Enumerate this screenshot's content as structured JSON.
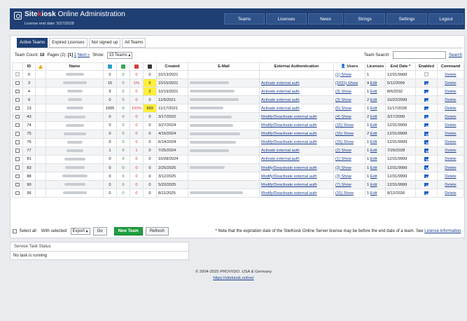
{
  "header": {
    "title_brand_1": "Site",
    "title_brand_2": "k",
    "title_brand_3": "iosk",
    "title_rest": " Online Administration",
    "license_end": "License end date: 5/27/2028",
    "nav": [
      "Teams",
      "Licenses",
      "News",
      "Strings",
      "Settings",
      "Logout"
    ]
  },
  "tabs": [
    "Active Teams",
    "Expired Licenses",
    "Not signed up",
    "All Teams"
  ],
  "toolbar": {
    "team_count_label": "Team Count:",
    "team_count": "18",
    "pages_label": "Pages (2):",
    "page_current": "[1]",
    "page_2": "2",
    "next": "Next »",
    "show_label": "Show:",
    "show_value": "15 Teams",
    "search_label": "Team Search:",
    "search_link": "Search"
  },
  "table": {
    "headers": [
      "",
      "ID",
      "",
      "Name",
      "",
      "",
      "",
      "",
      "Created",
      "E-Mail",
      "External Authentication",
      "Users",
      "Licenses",
      "End Date *",
      "Enabled",
      "Command"
    ],
    "rows": [
      {
        "id": "0",
        "n1": "0",
        "n2": "0",
        "n3": "0",
        "n4": "0",
        "created": "10/13/2021",
        "auth": "",
        "users": "(1) Show",
        "lic_n": "1",
        "lic_edit": "",
        "end": "12/31/9999",
        "cmd": "Delete"
      },
      {
        "id": "3",
        "n1": "15",
        "n2": "0",
        "n3": "1%",
        "n4": "5",
        "created": "10/15/2021",
        "auth": "Activate external auth",
        "users": "(1031) Show",
        "lic_n": "9",
        "lic_edit": "Edit",
        "end": "5/11/2099",
        "cmd": "Delete"
      },
      {
        "id": "4",
        "n1": "9",
        "n2": "0",
        "n3": "0",
        "n4": "2",
        "created": "10/19/2021",
        "auth": "Activate external auth",
        "users": "(3) Show",
        "lic_n": "1",
        "lic_edit": "Edit",
        "end": "8/6/2032",
        "cmd": "Delete"
      },
      {
        "id": "9",
        "n1": "0",
        "n2": "0",
        "n3": "0",
        "n4": "0",
        "created": "11/9/2021",
        "auth": "Activate external auth",
        "users": "(3) Show",
        "lic_n": "2",
        "lic_edit": "Edit",
        "end": "10/22/2099",
        "cmd": "Delete"
      },
      {
        "id": "13",
        "n1": "1005",
        "n2": "0",
        "n3": "100%",
        "n4": "999",
        "created": "11/17/2021",
        "auth": "Activate external auth",
        "users": "(5) Show",
        "lic_n": "1",
        "lic_edit": "Edit",
        "end": "11/17/2028",
        "cmd": "Delete"
      },
      {
        "id": "43",
        "n1": "0",
        "n2": "0",
        "n3": "0",
        "n4": "0",
        "created": "3/17/2022",
        "auth": "Modify/Deactivate external auth",
        "users": "(4) Show",
        "lic_n": "2",
        "lic_edit": "Edit",
        "end": "3/17/2099",
        "cmd": "Delete"
      },
      {
        "id": "74",
        "n1": "0",
        "n2": "0",
        "n3": "0",
        "n4": "0",
        "created": "3/27/2024",
        "auth": "Modify/Deactivate external auth",
        "users": "(15) Show",
        "lic_n": "1",
        "lic_edit": "Edit",
        "end": "12/31/9999",
        "cmd": "Delete"
      },
      {
        "id": "75",
        "n1": "0",
        "n2": "0",
        "n3": "0",
        "n4": "0",
        "created": "4/16/2024",
        "auth": "Modify/Deactivate external auth",
        "users": "(15) Show",
        "lic_n": "2",
        "lic_edit": "Edit",
        "end": "12/31/9999",
        "cmd": "Delete"
      },
      {
        "id": "76",
        "n1": "0",
        "n2": "0",
        "n3": "0",
        "n4": "0",
        "created": "6/14/2024",
        "auth": "Modify/Deactivate external auth",
        "users": "(15) Show",
        "lic_n": "1",
        "lic_edit": "Edit",
        "end": "12/31/9999",
        "cmd": "Delete"
      },
      {
        "id": "77",
        "n1": "1",
        "n2": "0",
        "n3": "1",
        "n4": "0",
        "created": "7/25/2024",
        "auth": "Activate external auth",
        "users": "(2) Show",
        "lic_n": "1",
        "lic_edit": "Edit",
        "end": "7/29/2028",
        "cmd": "Delete"
      },
      {
        "id": "81",
        "n1": "0",
        "n2": "0",
        "n3": "0",
        "n4": "0",
        "created": "10/28/2024",
        "auth": "Activate external auth",
        "users": "(1) Show",
        "lic_n": "1",
        "lic_edit": "Edit",
        "end": "12/31/9999",
        "cmd": "Delete"
      },
      {
        "id": "83",
        "n1": "0",
        "n2": "0",
        "n3": "0",
        "n4": "0",
        "created": "2/25/2025",
        "auth": "Modify/Deactivate external auth",
        "users": "(3) Show",
        "lic_n": "1",
        "lic_edit": "Edit",
        "end": "12/31/9999",
        "cmd": "Delete"
      },
      {
        "id": "88",
        "n1": "0",
        "n2": "0",
        "n3": "0",
        "n4": "0",
        "created": "3/12/2025",
        "auth": "Modify/Deactivate external auth",
        "users": "(3) Show",
        "lic_n": "1",
        "lic_edit": "Edit",
        "end": "12/31/9999",
        "cmd": "Delete"
      },
      {
        "id": "90",
        "n1": "0",
        "n2": "0",
        "n3": "0",
        "n4": "0",
        "created": "5/22/2025",
        "auth": "Modify/Deactivate external auth",
        "users": "(7) Show",
        "lic_n": "1",
        "lic_edit": "Edit",
        "end": "12/31/9999",
        "cmd": "Delete"
      },
      {
        "id": "96",
        "n1": "0",
        "n2": "0",
        "n3": "0",
        "n4": "0",
        "created": "8/11/2025",
        "auth": "Modify/Deactivate external auth",
        "users": "(15) Show",
        "lic_n": "1",
        "lic_edit": "Edit",
        "end": "8/12/2026",
        "cmd": "Delete"
      }
    ]
  },
  "bottom": {
    "select_all": "Select all",
    "with_selected": "With selected:",
    "export": "Export",
    "go": "Go",
    "new_team": "New Team",
    "refresh": "Refresh",
    "note": "* Note that the expiration date of the SiteKiosk Online Server license may be before the end date of a team. See",
    "note_link": "License information",
    "note_end": "."
  },
  "status": {
    "title": "Service Task Status",
    "text": "No task is running"
  },
  "footer": {
    "copyright": "© 2004-2025 PROVISIO. USA & Germany",
    "link": "https://sitekiosk.online/"
  },
  "colors": {
    "header_bg": "#1f3f73",
    "green": "#1e8e3e",
    "red": "#d13a3a",
    "highlight": "#ffef3a",
    "icon_teal": "#2ba0c8",
    "icon_green": "#3aaa52",
    "icon_red": "#d83b3b",
    "icon_dark": "#333333"
  }
}
